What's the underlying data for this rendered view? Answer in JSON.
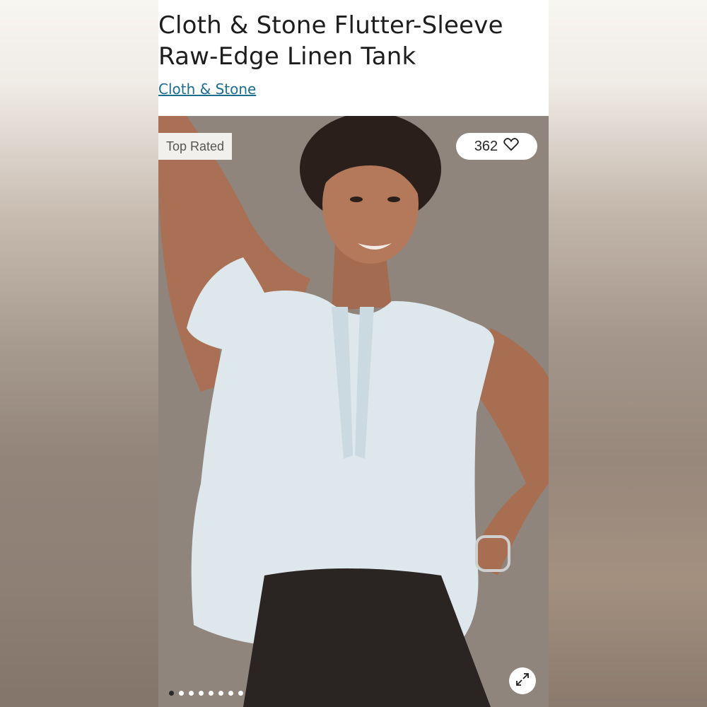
{
  "product": {
    "title_line1": "Cloth & Stone Flutter-Sleeve",
    "title_line2": "Raw-Edge Linen Tank",
    "brand": "Cloth & Stone"
  },
  "gallery": {
    "badge": "Top Rated",
    "likes_count": "362",
    "like_icon": "heart-icon",
    "expand_icon": "expand-icon",
    "pagination": {
      "total": 8,
      "active_index": 0
    }
  },
  "colors": {
    "brand_link": "#1c6e8c",
    "badge_bg": "#f2f0ed",
    "shirt": "#dde7ec",
    "skirt": "#2a2422"
  }
}
